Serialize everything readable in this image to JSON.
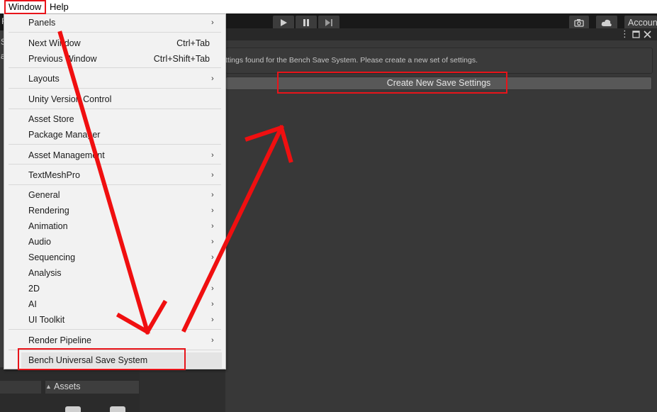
{
  "menubar": {
    "window": "Window",
    "help": "Help"
  },
  "toolbar": {
    "account": "Accoun",
    "left_cut": "F"
  },
  "inspector": {
    "help_text": "ttings found for the Bench Save System. Please create a new set of settings.",
    "create_button": "Create New Save Settings"
  },
  "left": {
    "cut1": "S",
    "cut2": "a"
  },
  "project": {
    "assets_tab": "Assets"
  },
  "menu": {
    "panels": "Panels",
    "next_window": "Next Window",
    "next_window_shortcut": "Ctrl+Tab",
    "previous_window": "Previous Window",
    "previous_window_shortcut": "Ctrl+Shift+Tab",
    "layouts": "Layouts",
    "unity_version_control": "Unity Version Control",
    "asset_store": "Asset Store",
    "package_manager": "Package Manager",
    "asset_management": "Asset Management",
    "textmeshpro": "TextMeshPro",
    "general": "General",
    "rendering": "Rendering",
    "animation": "Animation",
    "audio": "Audio",
    "sequencing": "Sequencing",
    "analysis": "Analysis",
    "two_d": "2D",
    "ai": "AI",
    "ui_toolkit": "UI Toolkit",
    "render_pipeline": "Render Pipeline",
    "bench_universal_save_system": "Bench Universal Save System",
    "submenu_arrow": "›"
  },
  "colors": {
    "annotation_red": "#e8141a",
    "menu_bg": "#f2f2f2",
    "editor_bg": "#383838"
  }
}
